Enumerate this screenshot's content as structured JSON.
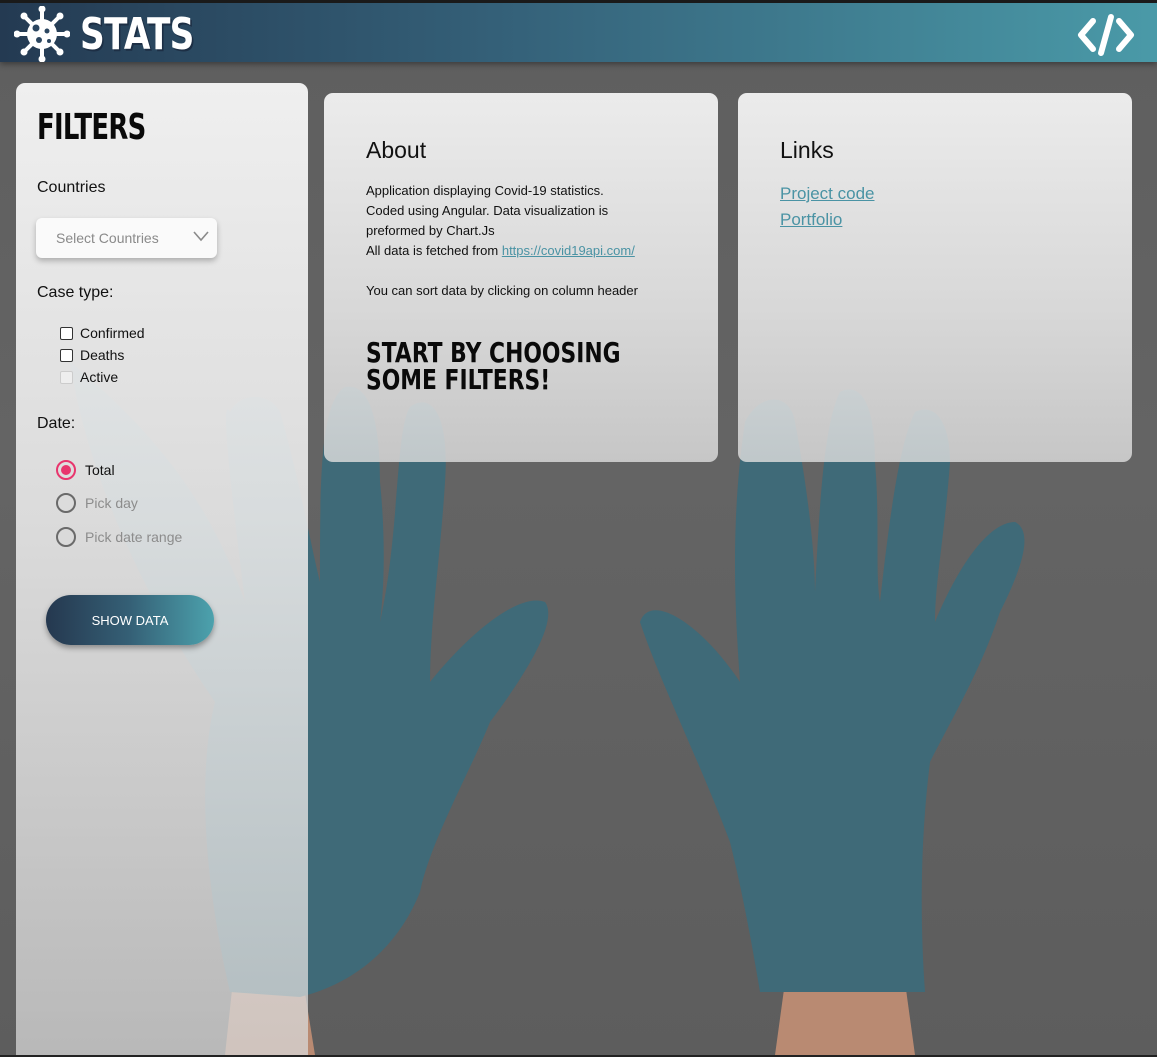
{
  "header": {
    "logo_icon": "virus-icon",
    "title": "STATS",
    "code_icon": "code-brackets-icon"
  },
  "filters": {
    "title": "FILTERS",
    "countries_label": "Countries",
    "countries_placeholder": "Select Countries",
    "case_type_label": "Case type:",
    "case_types": [
      {
        "label": "Confirmed",
        "checked": false,
        "disabled": false
      },
      {
        "label": "Deaths",
        "checked": false,
        "disabled": false
      },
      {
        "label": "Active",
        "checked": false,
        "disabled": true
      }
    ],
    "date_label": "Date:",
    "date_options": [
      {
        "label": "Total",
        "selected": true
      },
      {
        "label": "Pick day",
        "selected": false
      },
      {
        "label": "Pick date range",
        "selected": false
      }
    ],
    "show_button": "SHOW DATA"
  },
  "about": {
    "title": "About",
    "line1": "Application displaying Covid-19 statistics.",
    "line2": "Coded using Angular. Data visualization is",
    "line3": "preformed by Chart.Js",
    "line4_prefix": "All data is fetched from ",
    "link": "https://covid19api.com/",
    "line5": "You can sort data by clicking on column header",
    "cta": "START BY CHOOSING SOME FILTERS!"
  },
  "links": {
    "title": "Links",
    "items": [
      "Project code",
      "Portfolio"
    ]
  },
  "colors": {
    "accent_pink": "#e8356d",
    "link_teal": "#4a93a4",
    "header_dark": "#243a52",
    "header_light": "#4a9aa8"
  }
}
